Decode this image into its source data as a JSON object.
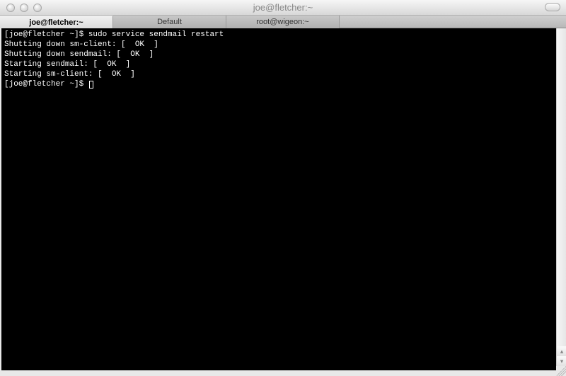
{
  "window": {
    "title": "joe@fletcher:~"
  },
  "tabs": [
    {
      "label": "joe@fletcher:~",
      "active": true
    },
    {
      "label": "Default",
      "active": false
    },
    {
      "label": "root@wigeon:~",
      "active": false
    }
  ],
  "terminal": {
    "lines": [
      "[joe@fletcher ~]$ sudo service sendmail restart",
      "Shutting down sm-client: [  OK  ]",
      "Shutting down sendmail: [  OK  ]",
      "Starting sendmail: [  OK  ]",
      "Starting sm-client: [  OK  ]"
    ],
    "prompt": "[joe@fletcher ~]$ "
  }
}
